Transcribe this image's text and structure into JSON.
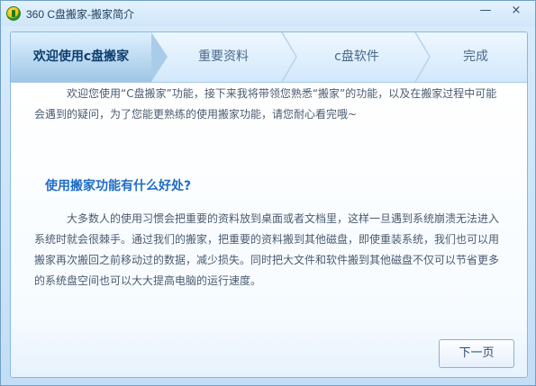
{
  "window": {
    "title": "360 C盘搬家-搬家简介",
    "minimize_label": "—",
    "close_label": "×"
  },
  "steps": [
    {
      "label": "欢迎使用c盘搬家",
      "active": true
    },
    {
      "label": "重要资料",
      "active": false
    },
    {
      "label": "c盘软件",
      "active": false
    },
    {
      "label": "完成",
      "active": false
    }
  ],
  "intro": {
    "text": "欢迎您使用“C盘搬家”功能，接下来我将带领您熟悉“搬家”的功能，以及在搬家过程中可能会遇到的疑问，为了您能更熟练的使用搬家功能，请您耐心看完哦~"
  },
  "section": {
    "heading": "使用搬家功能有什么好处?",
    "text": "大多数人的使用习惯会把重要的资料放到桌面或者文档里，这样一旦遇到系统崩溃无法进入系统时就会很棘手。通过我们的搬家，把重要的资料搬到其他磁盘，即使重装系统，我们也可以用搬家再次搬回之前移动过的数据，减少损失。同时把大文件和软件搬到其他磁盘不仅可以节省更多的系统盘空间也可以大大提高电脑的运行速度。"
  },
  "footer": {
    "next_label": "下一页"
  },
  "colors": {
    "accent": "#1e6dc6",
    "frame_border": "#86b9e1"
  }
}
